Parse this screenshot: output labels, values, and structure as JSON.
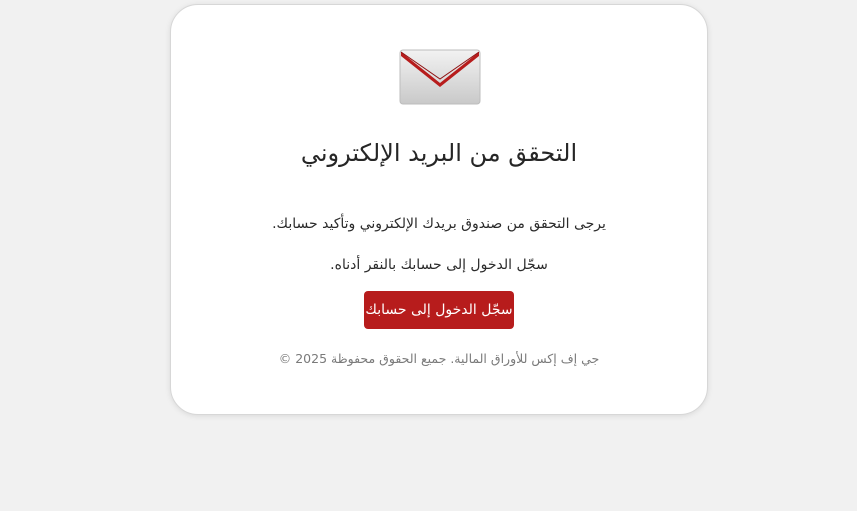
{
  "card": {
    "icon": "envelope-icon",
    "title": "التحقق من البريد الإلكتروني",
    "message": "يرجى التحقق من صندوق بريدك الإلكتروني وتأكيد حسابك.",
    "instruction": "سجّل الدخول إلى حسابك بالنقر أدناه.",
    "login_button_label": "سجّل الدخول إلى حسابك",
    "footer": "جي إف إكس للأوراق المالية. جميع الحقوق محفوظة 2025 ©"
  },
  "colors": {
    "accent": "#b71c1c",
    "background": "#f1f1f1",
    "card": "#ffffff"
  }
}
